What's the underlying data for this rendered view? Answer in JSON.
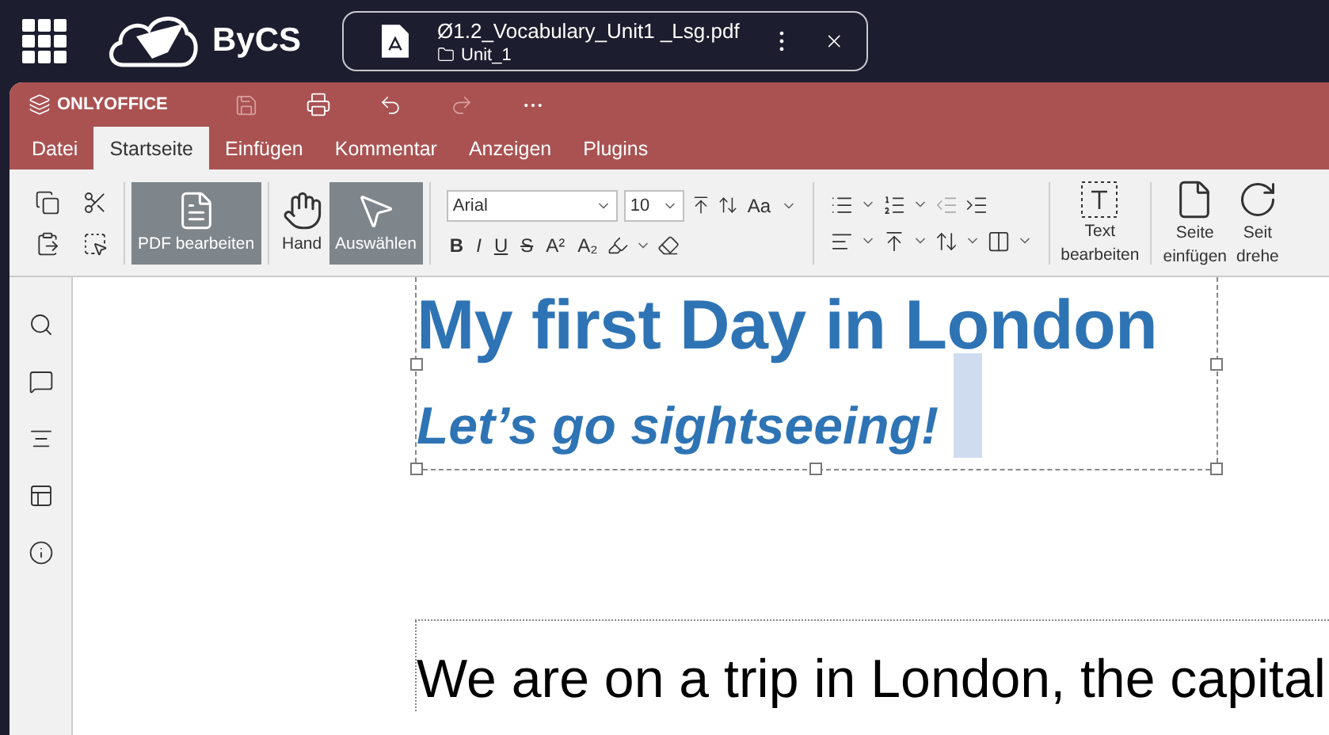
{
  "topbar": {
    "logo": "ByCS",
    "file": {
      "name": "Ø1.2_Vocabulary_Unit1 _Lsg.pdf",
      "folder": "Unit_1"
    }
  },
  "app": {
    "brand": "ONLYOFFICE"
  },
  "tabs": [
    {
      "label": "Datei",
      "selected": false
    },
    {
      "label": "Startseite",
      "selected": true
    },
    {
      "label": "Einfügen",
      "selected": false
    },
    {
      "label": "Kommentar",
      "selected": false
    },
    {
      "label": "Anzeigen",
      "selected": false
    },
    {
      "label": "Plugins",
      "selected": false
    }
  ],
  "toolbar": {
    "big_buttons": [
      {
        "kind": "pdf",
        "label": "PDF bearbeiten",
        "selected": true
      },
      {
        "kind": "hand",
        "label": "Hand",
        "selected": false
      },
      {
        "kind": "select",
        "label": "Auswählen",
        "selected": true
      }
    ],
    "font": "Arial",
    "size": "10",
    "case": "Aa",
    "format": [
      "B",
      "I",
      "U",
      "S",
      "A²",
      "A₂"
    ],
    "text_edit": "Text bearbeiten",
    "insert_page": [
      "Seite",
      "einfügen"
    ],
    "rotate_page": [
      "Seit",
      "drehe"
    ]
  },
  "document": {
    "title": "My first Day in London",
    "subtitle": "Let’s go sightseeing!",
    "body": "We are on a trip in London, the capital"
  }
}
